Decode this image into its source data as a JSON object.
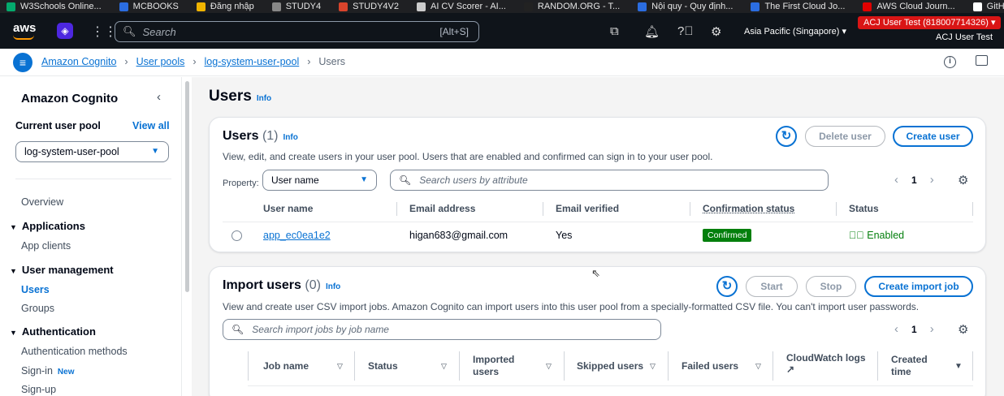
{
  "bookmarks": [
    {
      "label": "W3Schools Online...",
      "color": "#04aa6d"
    },
    {
      "label": "MCBOOKS",
      "color": "#2b6de0"
    },
    {
      "label": "Đăng nhập",
      "color": "#f0b400"
    },
    {
      "label": "STUDY4",
      "color": "#888888"
    },
    {
      "label": "STUDY4V2",
      "color": "#d9442c"
    },
    {
      "label": "AI CV Scorer - AI...",
      "color": "#cccccc"
    },
    {
      "label": "RANDOM.ORG - T...",
      "color": "#222222"
    },
    {
      "label": "Nội quy - Quy định...",
      "color": "#2b6de0"
    },
    {
      "label": "The First Cloud Jo...",
      "color": "#2b6de0"
    },
    {
      "label": "AWS Cloud Journ...",
      "color": "#e00000"
    },
    {
      "label": "GitHub FCAJ",
      "color": "#ffffff"
    }
  ],
  "topbar": {
    "logo": "aws",
    "search_placeholder": "Search",
    "search_shortcut": "[Alt+S]",
    "region": "Asia Pacific (Singapore) ▾",
    "account_badge": "ACJ User Test (818007714326) ▾",
    "account_name": "ACJ User Test"
  },
  "breadcrumb": {
    "items": [
      "Amazon Cognito",
      "User pools",
      "log-system-user-pool"
    ],
    "current": "Users"
  },
  "sidebar": {
    "title": "Amazon Cognito",
    "current_pool_label": "Current user pool",
    "view_all": "View all",
    "selected_pool": "log-system-user-pool",
    "overview": "Overview",
    "applications": "Applications",
    "app_clients": "App clients",
    "user_management": "User management",
    "users": "Users",
    "groups": "Groups",
    "authentication": "Authentication",
    "authentication_methods": "Authentication methods",
    "sign_in": "Sign-in",
    "new_badge": "New",
    "sign_up": "Sign-up"
  },
  "page": {
    "title": "Users",
    "info": "Info"
  },
  "users_card": {
    "title": "Users",
    "count": "(1)",
    "info": "Info",
    "description": "View, edit, and create users in your user pool. Users that are enabled and confirmed can sign in to your user pool.",
    "delete_label": "Delete user",
    "create_label": "Create user",
    "property_label": "Property:",
    "property_value": "User name",
    "search_placeholder": "Search users by attribute",
    "page": "1",
    "columns": [
      "User name",
      "Email address",
      "Email verified",
      "Confirmation status",
      "Status"
    ],
    "rows": [
      {
        "username": "app_ec0ea1e2",
        "email": "higan683@gmail.com",
        "verified": "Yes",
        "confirmation": "Confirmed",
        "status": "Enabled"
      }
    ]
  },
  "import_card": {
    "title": "Import users",
    "count": "(0)",
    "info": "Info",
    "description": "View and create user CSV import jobs. Amazon Cognito can import users into this user pool from a specially-formatted CSV file. You can't import user passwords.",
    "start_label": "Start",
    "stop_label": "Stop",
    "create_label": "Create import job",
    "search_placeholder": "Search import jobs by job name",
    "page": "1",
    "columns": [
      "Job name",
      "Status",
      "Imported users",
      "Skipped users",
      "Failed users",
      "CloudWatch logs",
      "Created time"
    ]
  },
  "colors": {
    "accent": "#0972d3",
    "success": "#037f0c",
    "topbar": "#0f141a",
    "account_badge": "#d91515"
  }
}
